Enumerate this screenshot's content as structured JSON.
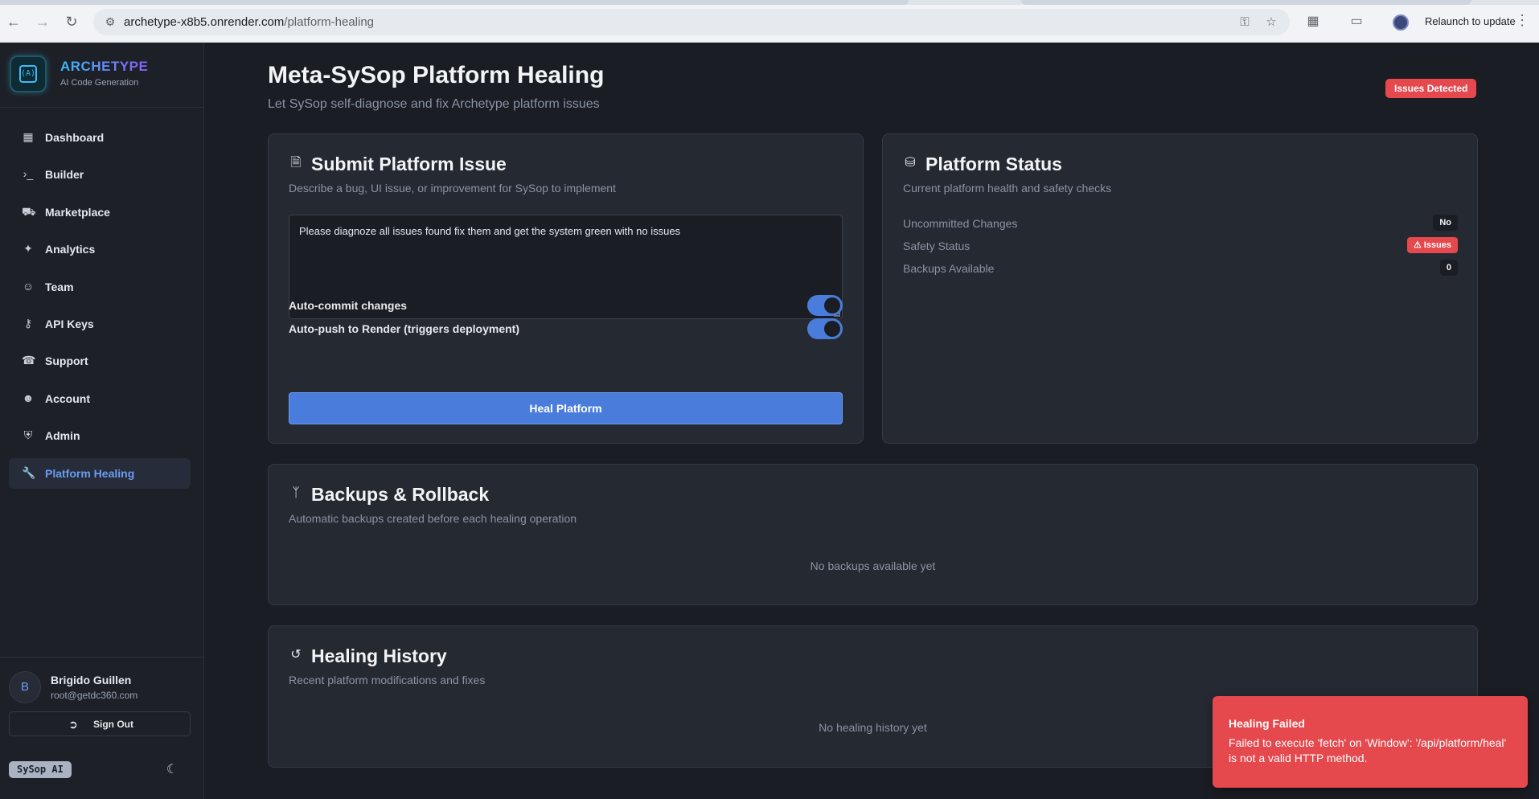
{
  "browser": {
    "url_host": "archetype-x8b5.onrender.com",
    "url_path": "/platform-healing",
    "relaunch_label": "Relaunch to update"
  },
  "brand": {
    "name": "ARCHETYPE",
    "tagline": "AI Code Generation",
    "logo_text": "(A)"
  },
  "sidebar": {
    "items": [
      {
        "label": "Dashboard",
        "icon": "grid-icon"
      },
      {
        "label": "Builder",
        "icon": "terminal-icon"
      },
      {
        "label": "Marketplace",
        "icon": "cart-icon"
      },
      {
        "label": "Analytics",
        "icon": "sparkles-icon"
      },
      {
        "label": "Team",
        "icon": "users-icon"
      },
      {
        "label": "API Keys",
        "icon": "key-icon"
      },
      {
        "label": "Support",
        "icon": "headset-icon"
      },
      {
        "label": "Account",
        "icon": "user-icon"
      },
      {
        "label": "Admin",
        "icon": "shield-icon"
      },
      {
        "label": "Platform Healing",
        "icon": "wrench-icon",
        "active": true
      }
    ],
    "user": {
      "initial": "B",
      "name": "Brigido Guillen",
      "email": "root@getdc360.com"
    },
    "signout_label": "Sign Out",
    "badge": "SySop AI"
  },
  "page": {
    "title": "Meta-SySop Platform Healing",
    "subtitle": "Let SySop self-diagnose and fix Archetype platform issues",
    "status_badge": "Issues Detected"
  },
  "submit": {
    "title": "Submit Platform Issue",
    "subtitle": "Describe a bug, UI issue, or improvement for SySop to implement",
    "textarea_value": "Please diagnoze all issues found fix them and get the system green with no issues",
    "toggles": [
      {
        "label": "Auto-commit changes",
        "on": true
      },
      {
        "label": "Auto-push to Render (triggers deployment)",
        "on": true
      }
    ],
    "button_label": "Heal Platform"
  },
  "status": {
    "title": "Platform Status",
    "subtitle": "Current platform health and safety checks",
    "rows": [
      {
        "key": "Uncommitted Changes",
        "value": "No"
      },
      {
        "key": "Safety Status",
        "value": "Issues"
      },
      {
        "key": "Backups Available",
        "value": "0"
      }
    ]
  },
  "backups": {
    "title": "Backups & Rollback",
    "subtitle": "Automatic backups created before each healing operation",
    "empty": "No backups available yet"
  },
  "history": {
    "title": "Healing History",
    "subtitle": "Recent platform modifications and fixes",
    "empty": "No healing history yet"
  },
  "toast": {
    "title": "Healing Failed",
    "body": "Failed to execute 'fetch' on 'Window': '/api/platform/heal' is not a valid HTTP method."
  },
  "colors": {
    "accent": "#4a7ddb",
    "danger": "#e5484d",
    "background": "#1a1d24",
    "card": "#252932"
  }
}
